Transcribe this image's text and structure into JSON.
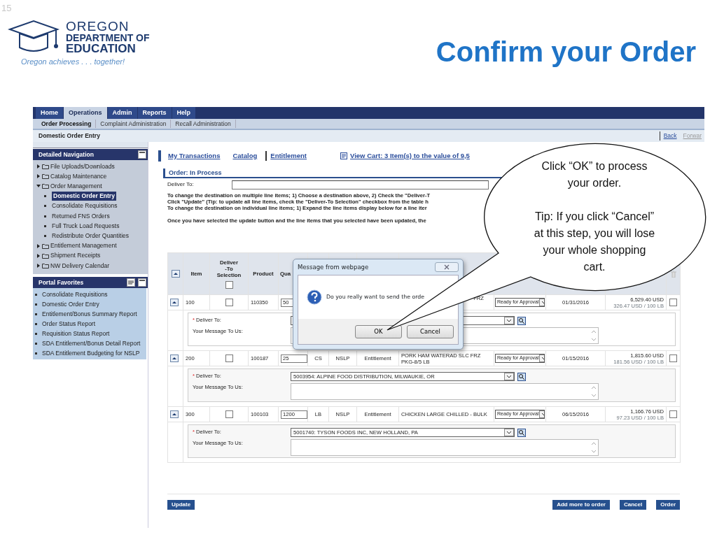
{
  "slide": {
    "number": "15",
    "title": "Confirm your Order",
    "logo": {
      "name_lines": [
        "OREGON",
        "DEPARTMENT OF",
        "EDUCATION"
      ],
      "tagline": "Oregon achieves . . . together!"
    }
  },
  "menu": [
    {
      "label": "Home",
      "selected": false
    },
    {
      "label": "Operations",
      "selected": true
    },
    {
      "label": "Admin",
      "selected": false
    },
    {
      "label": "Reports",
      "selected": false
    },
    {
      "label": "Help",
      "selected": false
    }
  ],
  "submenu": [
    {
      "label": "Order Processing",
      "selected": true
    },
    {
      "label": "Complaint Administration",
      "selected": false
    },
    {
      "label": "Recall Administration",
      "selected": false
    }
  ],
  "page_title": "Domestic Order Entry",
  "page_links": [
    {
      "label": "Back",
      "disabled": false
    },
    {
      "label": "Forwar",
      "disabled": true
    }
  ],
  "detailed_navigation": {
    "title": "Detailed Navigation",
    "items": [
      {
        "label": "File Uploads/Downloads",
        "expanded": false
      },
      {
        "label": "Catalog Maintenance",
        "expanded": false
      },
      {
        "label": "Order Management",
        "expanded": true,
        "children": [
          {
            "label": "Domestic Order Entry",
            "selected": true
          },
          {
            "label": "Consolidate Requisitions",
            "selected": false
          },
          {
            "label": "Returned FNS Orders",
            "selected": false
          },
          {
            "label": "Full Truck Load Requests",
            "selected": false
          },
          {
            "label": "Redistribute Order Quantities",
            "selected": false
          }
        ]
      },
      {
        "label": "Entitlement Management",
        "expanded": false
      },
      {
        "label": "Shipment Receipts",
        "expanded": false
      },
      {
        "label": "NW Delivery Calendar",
        "expanded": false
      }
    ]
  },
  "portal_favorites": {
    "title": "Portal Favorites",
    "items": [
      "Consolidate Requisitions",
      "Domestic Order Entry",
      "Entitlement/Bonus Summary Report",
      "Order Status Report",
      "Requisition Status Report",
      "SDA Entitlement/Bonus Detail Report",
      "SDA Entitlement Budgeting for NSLP"
    ]
  },
  "top_links": [
    {
      "label": "My Transactions",
      "kind": "link"
    },
    {
      "label": "Catalog",
      "kind": "link"
    },
    {
      "label": "Entitlement",
      "kind": "separated"
    },
    {
      "label": "View Cart: 3 Item(s) to the value of 9,5",
      "kind": "cart"
    }
  ],
  "order": {
    "title": "Order: In Process",
    "deliver_to_label": "Deliver To:",
    "instructions": [
      "To change the destination on multiple line items; 1) Choose a destination above, 2) Check the \"Deliver-T",
      "Click \"Update\" (Tip: to update all line items, check the \"Deliver-To Selection\" checkbox from the table h",
      "To change the destination on individual line items; 1) Expand the line items display below for a line iter"
    ],
    "note": "Once you have selected the update button and the line items that you selected have been updated, the",
    "table": {
      "columns": [
        {
          "label": "Item"
        },
        {
          "label": "Deliver\n-To\nSelection"
        },
        {
          "label": "Product"
        },
        {
          "label": "Qua"
        }
      ],
      "select_all_checked": false,
      "rows": [
        {
          "expanded": true,
          "item": "100",
          "checked": false,
          "product": "110350",
          "quantity": "50",
          "description": "FRZ",
          "status": "Ready for Approval",
          "date": "01/31/2016",
          "price": "6,529.40 USD",
          "unit_price": "326.47 USD / 100 LB",
          "marked": false,
          "required_mark": "*",
          "deliver_to_label": "Deliver To:",
          "message_label": "Your Message To Us:"
        },
        {
          "expanded": true,
          "item": "200",
          "checked": false,
          "product": "100187",
          "quantity": "25",
          "unit": "CS",
          "program": "NSLP",
          "type": "Entitlement",
          "description": "PORK HAM WATERAD SLC FRZ PKG-8/5 LB",
          "status": "Ready for Approval",
          "date": "01/15/2016",
          "price": "1,815.60 USD",
          "unit_price": "181.56 USD / 100 LB",
          "marked": false,
          "required_mark": "*",
          "deliver_to_label": "Deliver To:",
          "deliver_to": "5003954: ALPINE FOOD DISTRIBUTION, MILWAUKIE, OR",
          "message_label": "Your Message To Us:"
        },
        {
          "expanded": true,
          "item": "300",
          "checked": false,
          "product": "100103",
          "quantity": "1200",
          "unit": "LB",
          "program": "NSLP",
          "type": "Entitlement",
          "description": "CHICKEN LARGE CHILLED - BULK",
          "status": "Ready for Approval",
          "date": "06/15/2016",
          "price": "1,166.76 USD",
          "unit_price": "97.23 USD / 100 LB",
          "marked": false,
          "required_mark": "*",
          "deliver_to_label": "Deliver To:",
          "deliver_to": "5001740: TYSON FOODS INC, NEW HOLLAND, PA",
          "message_label": "Your Message To Us:"
        }
      ]
    },
    "buttons_left": [
      "Update"
    ],
    "buttons_right": [
      "Add more to order",
      "Cancel",
      "Order"
    ]
  },
  "dialog": {
    "title": "Message from webpage",
    "message": "Do you really want to send the orde",
    "buttons": [
      "OK",
      "Cancel"
    ]
  },
  "callout": {
    "paragraphs": [
      "Click “OK” to process\nyour order.",
      "Tip: If you click “Cancel”\nat this step, you will lose\nyour whole shopping\ncart."
    ]
  }
}
